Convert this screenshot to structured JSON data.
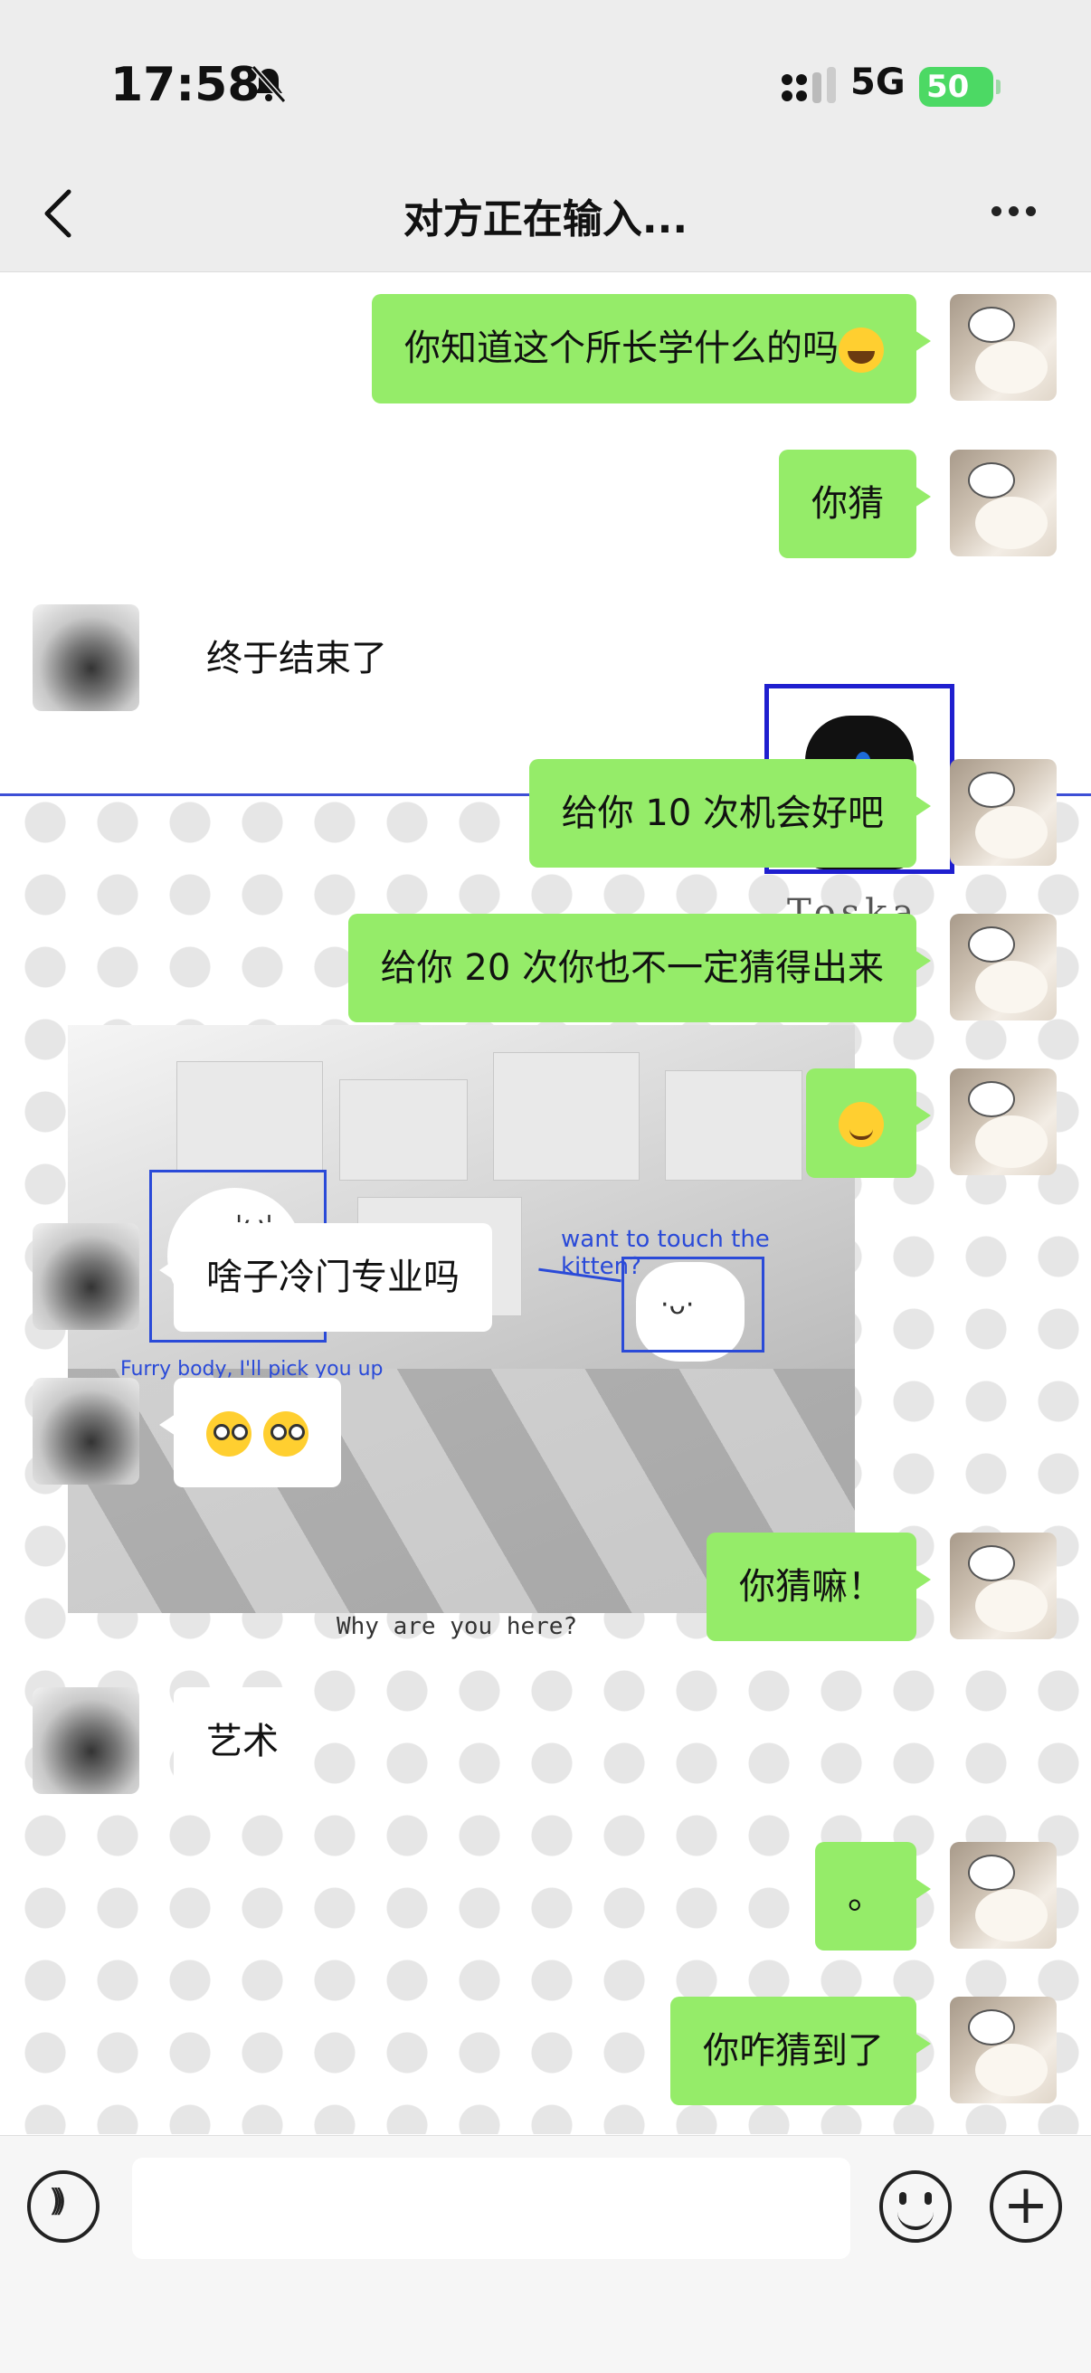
{
  "status": {
    "time": "17:58",
    "network": "5G",
    "battery": "50"
  },
  "header": {
    "title": "对方正在输入..."
  },
  "meme": {
    "caption_want": "want to touch the kitten?",
    "caption_furry": "Furry body, I'll pick you up",
    "caption_bottom": "Why are you here?",
    "watermark_text": "Toska",
    "face1": "'ω'",
    "face2": "·ᴗ·"
  },
  "messages": [
    {
      "side": "me",
      "text": "你知道这个所长学什么的吗",
      "emoji": "laugh"
    },
    {
      "side": "me",
      "text": "你猜"
    },
    {
      "side": "them",
      "text": "终于结束了"
    },
    {
      "side": "me",
      "text": "给你 10 次机会好吧"
    },
    {
      "side": "me",
      "text": "给你 20 次你也不一定猜得出来"
    },
    {
      "side": "me",
      "text": "",
      "emoji": "smirk"
    },
    {
      "side": "them",
      "text": "啥子冷门专业吗"
    },
    {
      "side": "them",
      "text": "",
      "emoji": "flushed-flushed"
    },
    {
      "side": "me",
      "text": "你猜嘛！"
    },
    {
      "side": "them",
      "text": "艺术"
    },
    {
      "side": "me",
      "text": "。"
    },
    {
      "side": "me",
      "text": "你咋猜到了"
    }
  ],
  "icons": [
    "chevron-left-icon",
    "more-icon",
    "bell-slash-icon",
    "signal-icon",
    "voice-icon",
    "emoji-icon",
    "plus-icon"
  ]
}
